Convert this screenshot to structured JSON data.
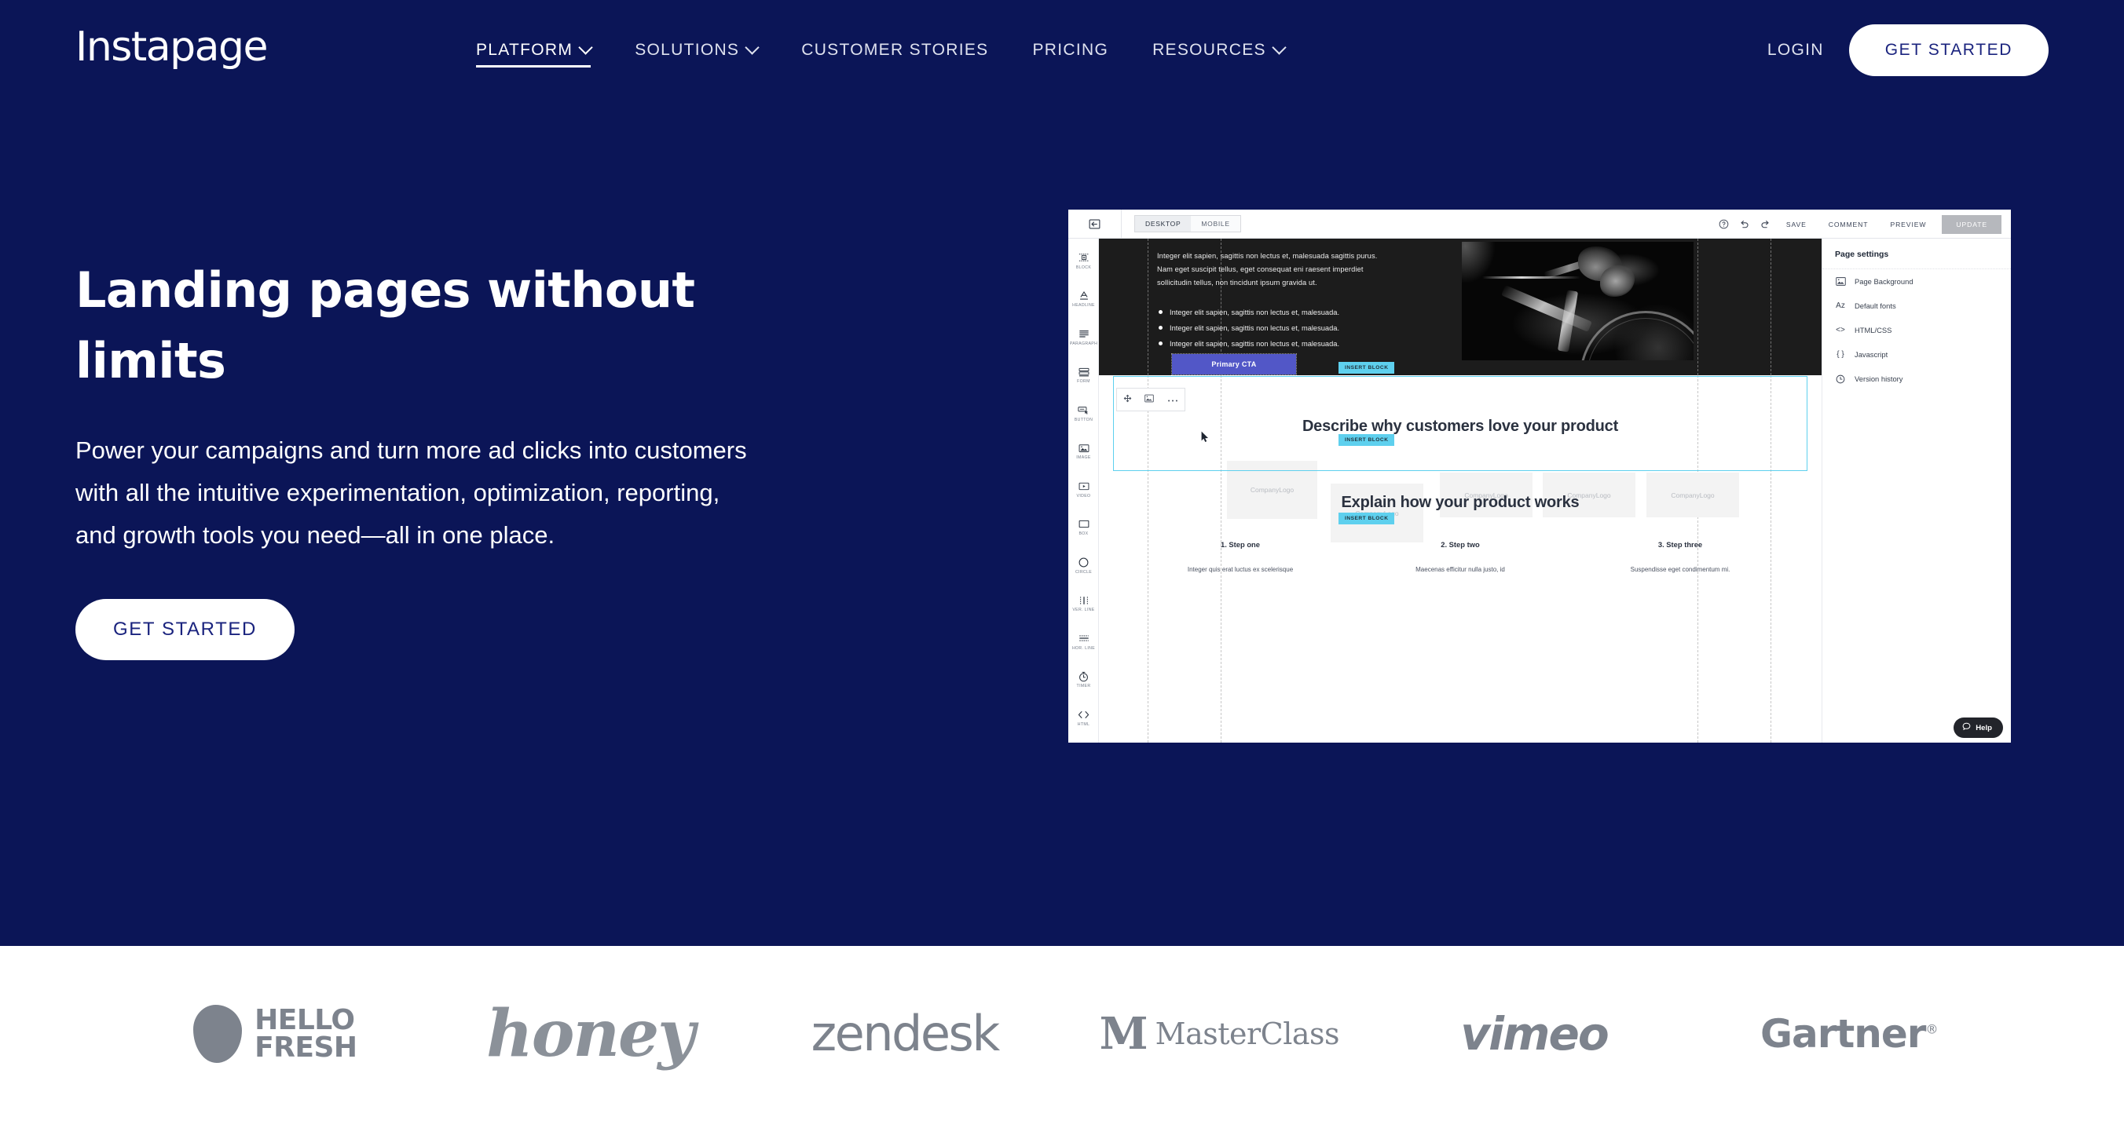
{
  "theme": {
    "navy": "#0B1557",
    "white": "#FFFFFF",
    "logo_gray": "#7D838D",
    "accent_cyan": "#5ED0EE",
    "cta_purple": "#5257C7"
  },
  "nav": {
    "logo": "Instapage",
    "items": [
      {
        "label": "PLATFORM",
        "has_chevron": true,
        "active": true
      },
      {
        "label": "SOLUTIONS",
        "has_chevron": true,
        "active": false
      },
      {
        "label": "CUSTOMER STORIES",
        "has_chevron": false,
        "active": false
      },
      {
        "label": "PRICING",
        "has_chevron": false,
        "active": false
      },
      {
        "label": "RESOURCES",
        "has_chevron": true,
        "active": false
      }
    ],
    "login_label": "LOGIN",
    "cta_label": "GET STARTED"
  },
  "hero": {
    "title": "Landing pages without limits",
    "subtitle": "Power your campaigns and turn more ad clicks into customers with all the intuitive experimentation, optimization, reporting, and growth tools you need—all in one place.",
    "cta_label": "GET STARTED"
  },
  "editor": {
    "back_icon": "back-arrow-icon",
    "device_tabs": [
      {
        "label": "DESKTOP",
        "active": true
      },
      {
        "label": "MOBILE",
        "active": false
      }
    ],
    "top_icons": [
      "help-circle-icon",
      "undo-icon",
      "redo-icon"
    ],
    "actions": [
      "SAVE",
      "COMMENT",
      "PREVIEW"
    ],
    "update_label": "UPDATE",
    "rail": [
      {
        "label": "BLOCK",
        "icon": "block-icon"
      },
      {
        "label": "HEADLINE",
        "icon": "headline-icon"
      },
      {
        "label": "PARAGRAPH",
        "icon": "paragraph-icon"
      },
      {
        "label": "FORM",
        "icon": "form-icon"
      },
      {
        "label": "BUTTON",
        "icon": "button-icon"
      },
      {
        "label": "IMAGE",
        "icon": "image-icon"
      },
      {
        "label": "VIDEO",
        "icon": "video-icon"
      },
      {
        "label": "BOX",
        "icon": "box-icon"
      },
      {
        "label": "CIRCLE",
        "icon": "circle-icon"
      },
      {
        "label": "VER. LINE",
        "icon": "vertical-line-icon"
      },
      {
        "label": "HOR. LINE",
        "icon": "horizontal-line-icon"
      },
      {
        "label": "TIMER",
        "icon": "timer-icon"
      },
      {
        "label": "HTML",
        "icon": "html-icon"
      }
    ],
    "canvas": {
      "paragraph_lines": [
        "Integer elit sapien, sagittis non lectus et, malesuada sagittis purus.",
        "Nam eget suscipit tellus, eget consequat eni raesent imperdiet",
        "sollicitudin tellus, non tincidunt ipsum gravida ut."
      ],
      "bullets": [
        "Integer elit sapien, sagittis non lectus et, malesuada.",
        "Integer elit sapien, sagittis non lectus et, malesuada.",
        "Integer elit sapien, sagittis non lectus et, malesuada."
      ],
      "cta_label": "Primary CTA",
      "insert_block_label": "INSERT BLOCK",
      "heading_1": "Describe why customers love your product",
      "logo_placeholders": [
        "CompanyLogo",
        "CompanyLogo",
        "CompanyLogo",
        "CompanyLogo",
        "CompanyLogo",
        "CompanyLogo"
      ],
      "heading_2": "Explain how your product works",
      "steps": [
        {
          "title": "1. Step one",
          "body": "Integer quis erat luctus ex scelerisque"
        },
        {
          "title": "2. Step two",
          "body": "Maecenas efficitur nulla justo, id"
        },
        {
          "title": "3. Step three",
          "body": "Suspendisse eget condimentum mi."
        }
      ]
    },
    "panel": {
      "title": "Page settings",
      "items": [
        {
          "label": "Page Background",
          "icon": "picture-icon",
          "glyph": "⊡"
        },
        {
          "label": "Default fonts",
          "icon": "font-icon",
          "glyph": "Az"
        },
        {
          "label": "HTML/CSS",
          "icon": "code-icon",
          "glyph": "<>"
        },
        {
          "label": "Javascript",
          "icon": "braces-icon",
          "glyph": "{ }"
        },
        {
          "label": "Version history",
          "icon": "history-icon",
          "glyph": "◷"
        }
      ]
    },
    "help_fab": {
      "label": "Help",
      "icon": "chat-bubble-icon"
    }
  },
  "logos": [
    {
      "name": "HelloFresh",
      "line1": "HELLO",
      "line2": "FRESH"
    },
    {
      "name": "honey",
      "text": "honey"
    },
    {
      "name": "zendesk",
      "text": "zendesk"
    },
    {
      "name": "MasterClass",
      "mark": "M",
      "text": "MasterClass"
    },
    {
      "name": "vimeo",
      "text": "vimeo"
    },
    {
      "name": "Gartner",
      "text": "Gartner",
      "mark": "®"
    }
  ]
}
